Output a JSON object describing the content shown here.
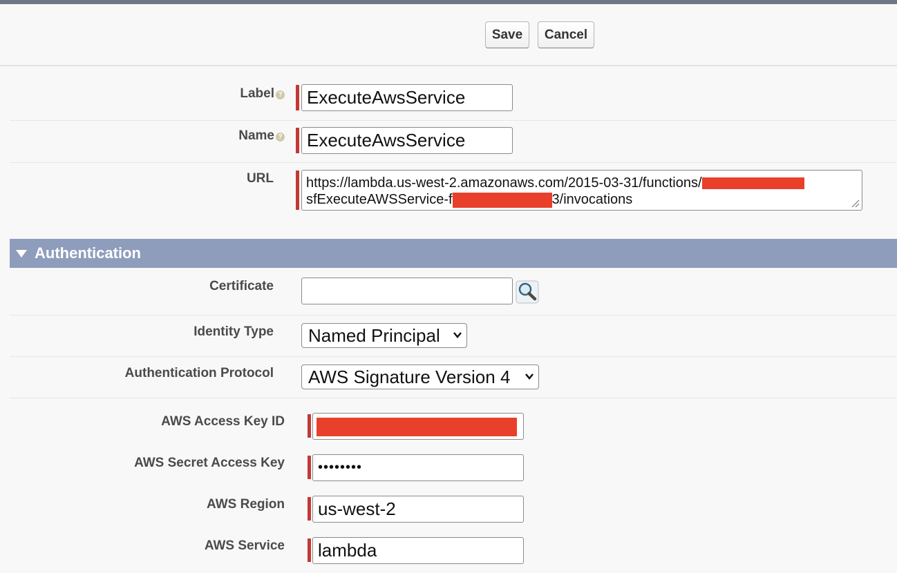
{
  "toolbar": {
    "save_label": "Save",
    "cancel_label": "Cancel"
  },
  "form": {
    "label": {
      "label": "Label",
      "value": "ExecuteAwsService",
      "help_icon": "question-icon"
    },
    "name": {
      "label": "Name",
      "value": "ExecuteAwsService",
      "help_icon": "question-icon"
    },
    "url": {
      "label": "URL",
      "line1_visible": "https://lambda.us-west-2.amazonaws.com/2015-03-31/functions/",
      "line2_prefix": "sfExecuteAWSService-f",
      "line2_suffix": "3/invocations"
    }
  },
  "authentication": {
    "section_title": "Authentication",
    "certificate": {
      "label": "Certificate",
      "value": "",
      "lookup_icon": "magnifier-lookup-icon"
    },
    "identity_type": {
      "label": "Identity Type",
      "selected": "Named Principal"
    },
    "auth_protocol": {
      "label": "Authentication Protocol",
      "selected": "AWS Signature Version 4"
    },
    "access_key_id": {
      "label": "AWS Access Key ID"
    },
    "secret_access_key": {
      "label": "AWS Secret Access Key",
      "masked_value": "••••••••"
    },
    "region": {
      "label": "AWS Region",
      "value": "us-west-2"
    },
    "service": {
      "label": "AWS Service",
      "value": "lambda"
    }
  },
  "colors": {
    "required_bar": "#c23934",
    "section_header": "#8e9dbc",
    "redaction": "#e8402a"
  }
}
